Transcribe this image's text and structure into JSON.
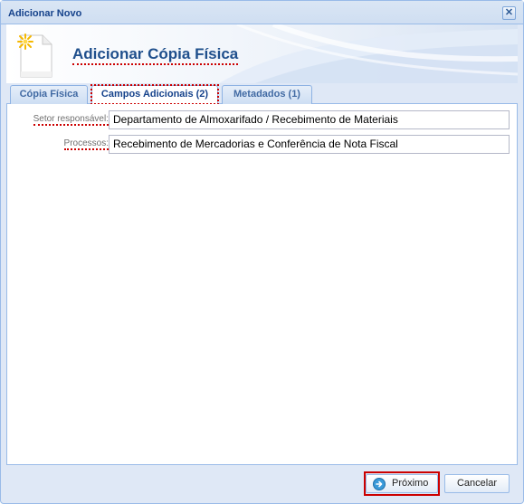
{
  "window": {
    "title": "Adicionar Novo",
    "close_glyph": "✕"
  },
  "header": {
    "title": "Adicionar Cópia Física",
    "icon": "new-document-icon"
  },
  "tabs": [
    {
      "label": "Cópia Física",
      "active": false
    },
    {
      "label": "Campos Adicionais (2)",
      "active": true
    },
    {
      "label": "Metadados (1)",
      "active": false
    }
  ],
  "form": {
    "fields": [
      {
        "label": "Setor responsável:",
        "value": "Departamento de Almoxarifado / Recebimento de Materiais"
      },
      {
        "label": "Processos:",
        "value": "Recebimento de Mercadorias e Conferência de Nota Fiscal"
      }
    ]
  },
  "buttons": {
    "next_label": "Próximo",
    "next_icon": "arrow-right-circle-icon",
    "cancel_label": "Cancelar"
  },
  "colors": {
    "accent": "#15428b",
    "highlight": "#cc0000",
    "window_bg": "#dfe8f6"
  }
}
